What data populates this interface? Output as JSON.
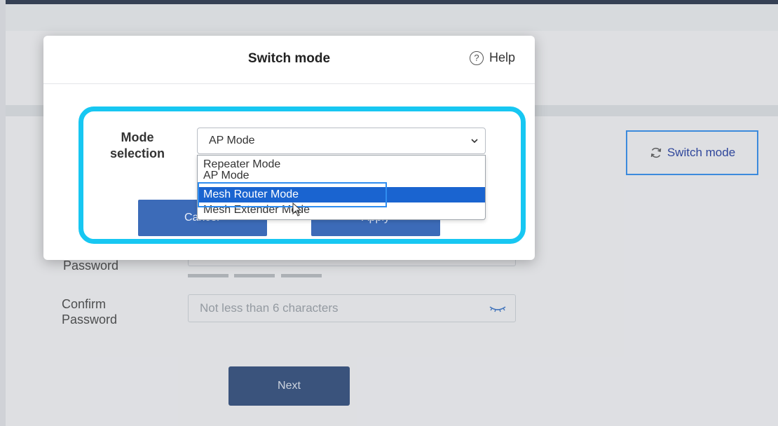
{
  "background": {
    "switch_mode_button": "Switch mode",
    "password_label": "Password",
    "confirm_label_line1": "Confirm",
    "confirm_label_line2": "Password",
    "confirm_placeholder": "Not less than 6 characters",
    "next_button": "Next"
  },
  "modal": {
    "title": "Switch mode",
    "help_label": "Help",
    "mode_label_line1": "Mode",
    "mode_label_line2": "selection",
    "selected_value": "AP Mode",
    "options": [
      "Repeater Mode",
      "AP Mode",
      "Mesh Router Mode",
      "Mesh Extender Mode"
    ],
    "highlighted_option": "Mesh Router Mode",
    "cancel_button": "Cancel",
    "apply_button": "Apply"
  },
  "colors": {
    "highlight_frame": "#17c7f2",
    "primary_button": "#3c6bb8",
    "selected_option": "#1a64d0",
    "outline_blue": "#2f8df0"
  },
  "icons": [
    "refresh-icon",
    "eye-icon",
    "help-icon",
    "chevron-down-icon",
    "cursor-icon"
  ]
}
